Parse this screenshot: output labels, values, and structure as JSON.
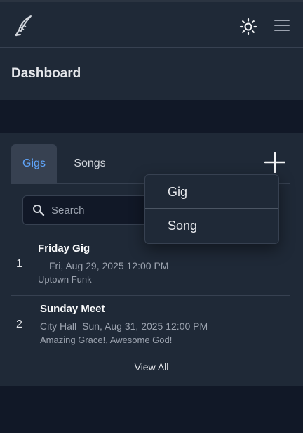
{
  "header": {
    "logo_icon": "quill-pen-icon",
    "theme_icon": "sun-icon",
    "menu_icon": "hamburger-menu-icon",
    "page_title": "Dashboard"
  },
  "tabs": [
    {
      "label": "Gigs",
      "active": true
    },
    {
      "label": "Songs",
      "active": false
    }
  ],
  "add_icon": "plus-icon",
  "search": {
    "placeholder": "Search",
    "value": "",
    "icon": "search-icon"
  },
  "gigs": [
    {
      "number": "1",
      "title": "Friday Gig",
      "venue": "",
      "datetime": "Fri, Aug 29, 2025 12:00 PM",
      "songs": "Uptown Funk"
    },
    {
      "number": "2",
      "title": "Sunday Meet",
      "venue": "City Hall",
      "datetime": "Sun, Aug 31, 2025 12:00 PM",
      "songs": "Amazing Grace!, Awesome God!"
    }
  ],
  "view_all_label": "View All",
  "dropdown": {
    "items": [
      {
        "label": "Gig"
      },
      {
        "label": "Song"
      }
    ]
  },
  "colors": {
    "background": "#111827",
    "surface": "#1f2937",
    "accent": "#60a5fa",
    "border": "#374151"
  }
}
